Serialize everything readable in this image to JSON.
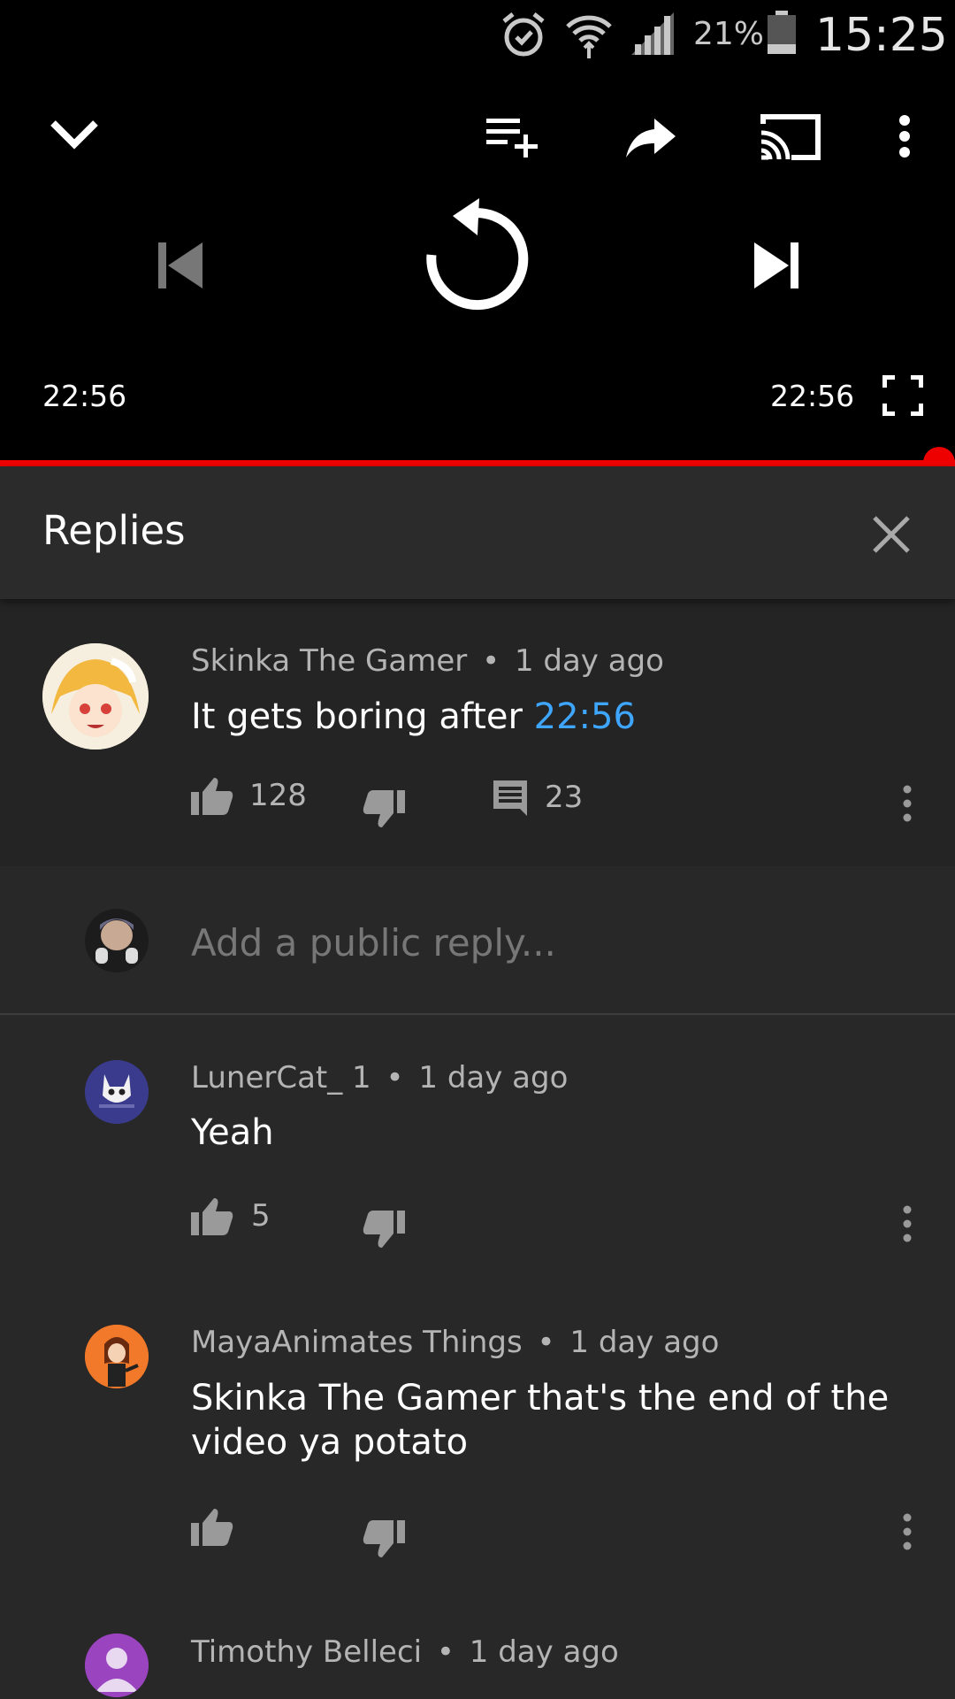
{
  "status_bar": {
    "battery_percent": "21%",
    "clock": "15:25"
  },
  "player": {
    "current_time": "22:56",
    "duration": "22:56",
    "progress_fraction": 1.0,
    "accent_color": "#ff0000"
  },
  "replies_panel": {
    "title": "Replies"
  },
  "parent_comment": {
    "author": "Skinka The Gamer",
    "age": "1 day ago",
    "text": "It gets boring after ",
    "timestamp_link": "22:56",
    "likes": "128",
    "reply_count": "23"
  },
  "reply_input": {
    "placeholder": "Add a public reply..."
  },
  "replies": [
    {
      "author": "LunerCat_ 1",
      "age": "1 day ago",
      "text": "Yeah",
      "likes": "5"
    },
    {
      "author": "MayaAnimates Things",
      "age": "1 day ago",
      "text_line1": "Skinka The Gamer that's the end of the",
      "text_line2": "video ya potato",
      "likes": ""
    },
    {
      "author": "Timothy Belleci",
      "age": "1 day ago"
    }
  ],
  "separator": "•"
}
